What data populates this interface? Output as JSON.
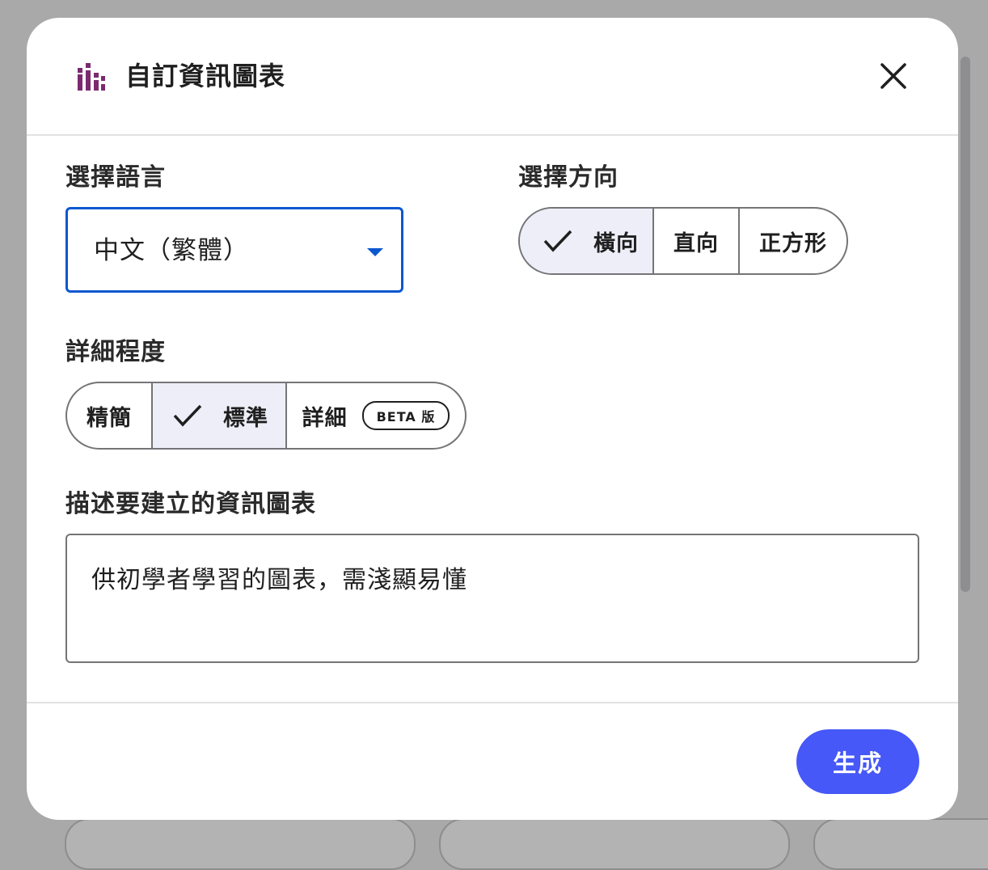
{
  "dialog": {
    "title": "自訂資訊圖表",
    "accent_color": "#7b2a6e"
  },
  "language": {
    "label": "選擇語言",
    "selected": "中文（繁體）"
  },
  "orientation": {
    "label": "選擇方向",
    "options": [
      {
        "label": "橫向",
        "selected": true
      },
      {
        "label": "直向",
        "selected": false
      },
      {
        "label": "正方形",
        "selected": false
      }
    ]
  },
  "detail": {
    "label": "詳細程度",
    "options": [
      {
        "label": "精簡",
        "selected": false
      },
      {
        "label": "標準",
        "selected": true
      },
      {
        "label": "詳細",
        "selected": false,
        "badge": "BETA 版"
      }
    ]
  },
  "description": {
    "label": "描述要建立的資訊圖表",
    "value": "供初學者學習的圖表，需淺顯易懂"
  },
  "footer": {
    "generate_label": "生成",
    "button_color": "#4658f7"
  }
}
